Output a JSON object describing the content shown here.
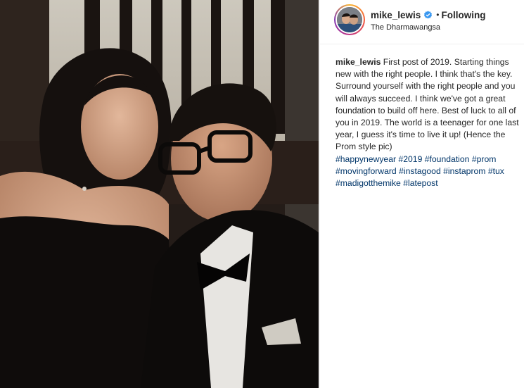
{
  "post": {
    "username": "mike_lewis",
    "separator": "•",
    "follow_label": "Following",
    "location": "The Dharmawangsa",
    "caption_text": "First post of 2019. Starting things new with the right people. I think that's the key. Surround yourself with the right people and you will always succeed. I think we've got a great foundation to build off here. Best of luck to all of you in 2019. The world is a teenager for one last year, I guess it's time to live it up! (Hence the Prom style pic)",
    "hashtags": [
      "#happynewyear",
      "#2019",
      "#foundation",
      "#prom",
      "#movingforward",
      "#instagood",
      "#instaprom",
      "#tux",
      "#madigotthemike",
      "#latepost"
    ]
  },
  "icons": {
    "verified": "verified-badge-icon",
    "avatar": "profile-avatar"
  },
  "colors": {
    "hashtag": "#003569",
    "verified": "#3897f0",
    "text": "#262626"
  }
}
